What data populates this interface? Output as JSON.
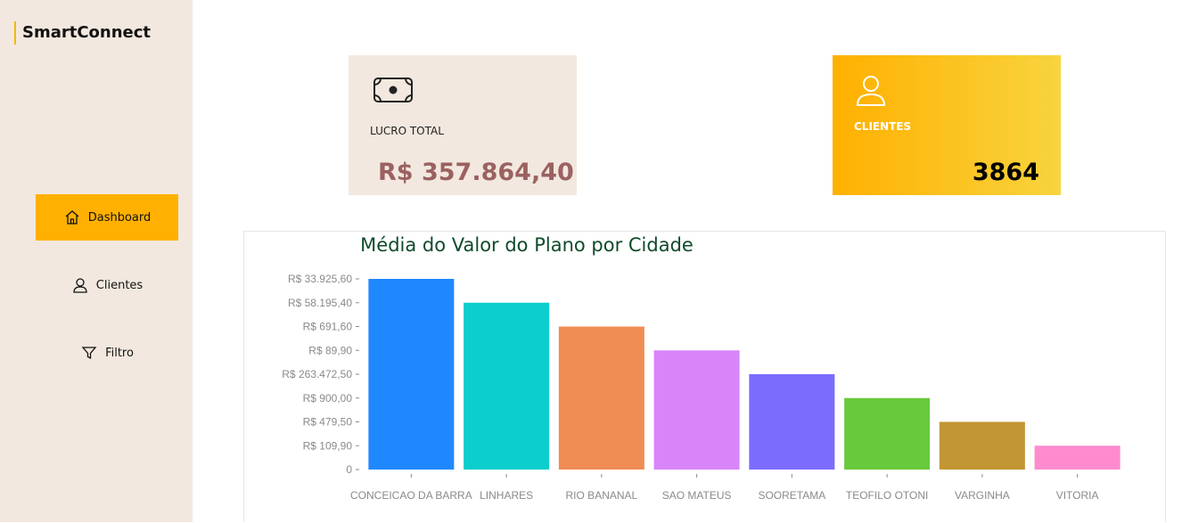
{
  "app": {
    "name": "SmartConnect",
    "accent": "#ffb000"
  },
  "sidebar": {
    "items": [
      {
        "label": "Dashboard",
        "icon": "home-icon",
        "active": true
      },
      {
        "label": "Clientes",
        "icon": "user-icon",
        "active": false
      },
      {
        "label": "Filtro",
        "icon": "filter-icon",
        "active": false
      }
    ]
  },
  "kpis": {
    "lucro": {
      "label": "LUCRO TOTAL",
      "value": "R$ 357.864,40",
      "icon": "money-icon",
      "value_color": "#9b6161"
    },
    "clientes": {
      "label": "CLIENTES",
      "value": "3864",
      "icon": "user-icon"
    }
  },
  "chart_data": {
    "type": "bar",
    "title": "Média do Valor do Plano por Cidade",
    "xlabel": "",
    "ylabel": "",
    "categories": [
      "CONCEICAO DA BARRA",
      "LINHARES",
      "RIO BANANAL",
      "SAO MATEUS",
      "SOORETAMA",
      "TEOFILO OTONI",
      "VARGINHA",
      "VITORIA"
    ],
    "values": [
      8,
      7,
      6,
      5,
      4,
      3,
      2,
      1
    ],
    "colors": [
      "#2088ff",
      "#0ccecc",
      "#f08d55",
      "#d885fa",
      "#7b6cfe",
      "#68c93c",
      "#c29634",
      "#fe8bce"
    ],
    "y_ticks": [
      "0",
      "R$ 109,90",
      "R$ 479,50",
      "R$ 900,00",
      "R$ 263.472,50",
      "R$ 89,90",
      "R$ 691,60",
      "R$ 58.195,40",
      "R$ 33.925,60"
    ],
    "ylim": [
      0,
      8
    ],
    "grid": false,
    "legend": "none"
  }
}
